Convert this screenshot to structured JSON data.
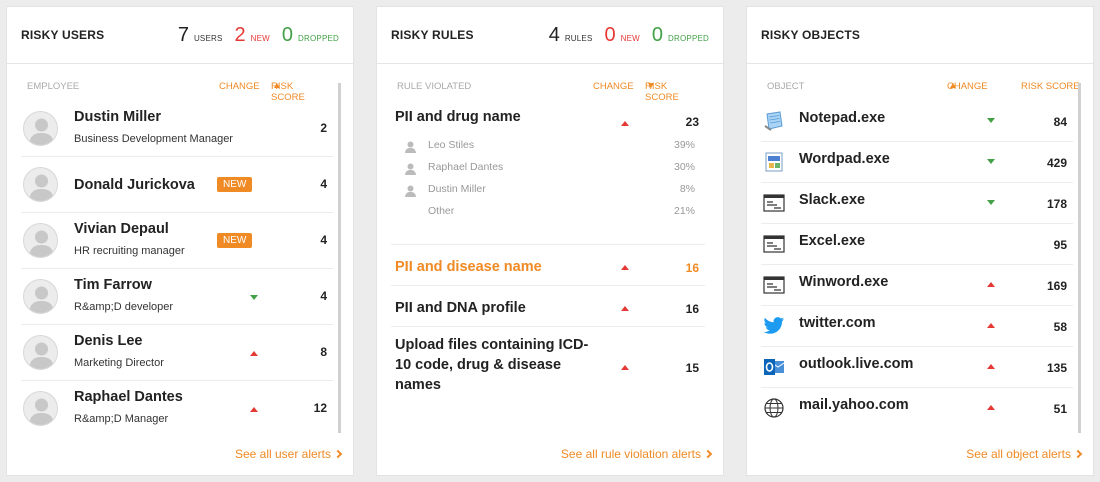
{
  "users_panel": {
    "title": "RISKY USERS",
    "stats": [
      {
        "value": "7",
        "label": "USERS"
      },
      {
        "value": "2",
        "label": "NEW"
      },
      {
        "value": "0",
        "label": "DROPPED"
      }
    ],
    "col_left": "EMPLOYEE",
    "col_change": "CHANGE",
    "col_score": "RISK SCORE",
    "rows": [
      {
        "name": "Dustin Miller",
        "role": "Business Development Manager",
        "badge": "",
        "change": "",
        "score": "2"
      },
      {
        "name": "Donald Jurickova",
        "role": "",
        "badge": "NEW",
        "change": "",
        "score": "4"
      },
      {
        "name": "Vivian Depaul",
        "role": "HR recruiting manager",
        "badge": "NEW",
        "change": "",
        "score": "4"
      },
      {
        "name": "Tim Farrow",
        "role": "R&amp;D developer",
        "badge": "",
        "change": "down",
        "score": "4"
      },
      {
        "name": "Denis Lee",
        "role": "Marketing Director",
        "badge": "",
        "change": "up",
        "score": "8"
      },
      {
        "name": "Raphael Dantes",
        "role": "R&amp;D Manager",
        "badge": "",
        "change": "up",
        "score": "12"
      }
    ],
    "footer": "See all user alerts"
  },
  "rules_panel": {
    "title": "RISKY RULES",
    "stats": [
      {
        "value": "4",
        "label": "RULES"
      },
      {
        "value": "0",
        "label": "NEW"
      },
      {
        "value": "0",
        "label": "DROPPED"
      }
    ],
    "col_left": "RULE VIOLATED",
    "col_change": "CHANGE",
    "col_score": "RISK SCORE",
    "rows": [
      {
        "name": "PII and drug name",
        "change": "up",
        "score": "23",
        "highlight": false,
        "breakdown": [
          {
            "name": "Leo Stiles",
            "pct": "39%"
          },
          {
            "name": "Raphael Dantes",
            "pct": "30%"
          },
          {
            "name": "Dustin Miller",
            "pct": "8%"
          },
          {
            "name": "Other",
            "pct": "21%"
          }
        ]
      },
      {
        "name": "PII and disease name",
        "change": "up",
        "score": "16",
        "highlight": true
      },
      {
        "name": "PII and DNA profile",
        "change": "up",
        "score": "16",
        "highlight": false
      },
      {
        "name": "Upload files containing ICD-10 code, drug & disease names",
        "change": "up",
        "score": "15",
        "highlight": false
      }
    ],
    "footer": "See all rule violation alerts"
  },
  "objects_panel": {
    "title": "RISKY OBJECTS",
    "col_left": "OBJECT",
    "col_change": "CHANGE",
    "col_score": "RISK SCORE",
    "rows": [
      {
        "name": "Notepad.exe",
        "icon": "notepad-icon",
        "change": "down",
        "score": "84"
      },
      {
        "name": "Wordpad.exe",
        "icon": "wordpad-icon",
        "change": "down",
        "score": "429"
      },
      {
        "name": "Slack.exe",
        "icon": "window-icon",
        "change": "down",
        "score": "178"
      },
      {
        "name": "Excel.exe",
        "icon": "window-icon",
        "change": "",
        "score": "95"
      },
      {
        "name": "Winword.exe",
        "icon": "window-icon",
        "change": "up",
        "score": "169"
      },
      {
        "name": "twitter.com",
        "icon": "twitter-icon",
        "change": "up",
        "score": "58"
      },
      {
        "name": "outlook.live.com",
        "icon": "outlook-icon",
        "change": "up",
        "score": "135"
      },
      {
        "name": "mail.yahoo.com",
        "icon": "globe-icon",
        "change": "up",
        "score": "51"
      }
    ],
    "footer": "See all object alerts"
  }
}
